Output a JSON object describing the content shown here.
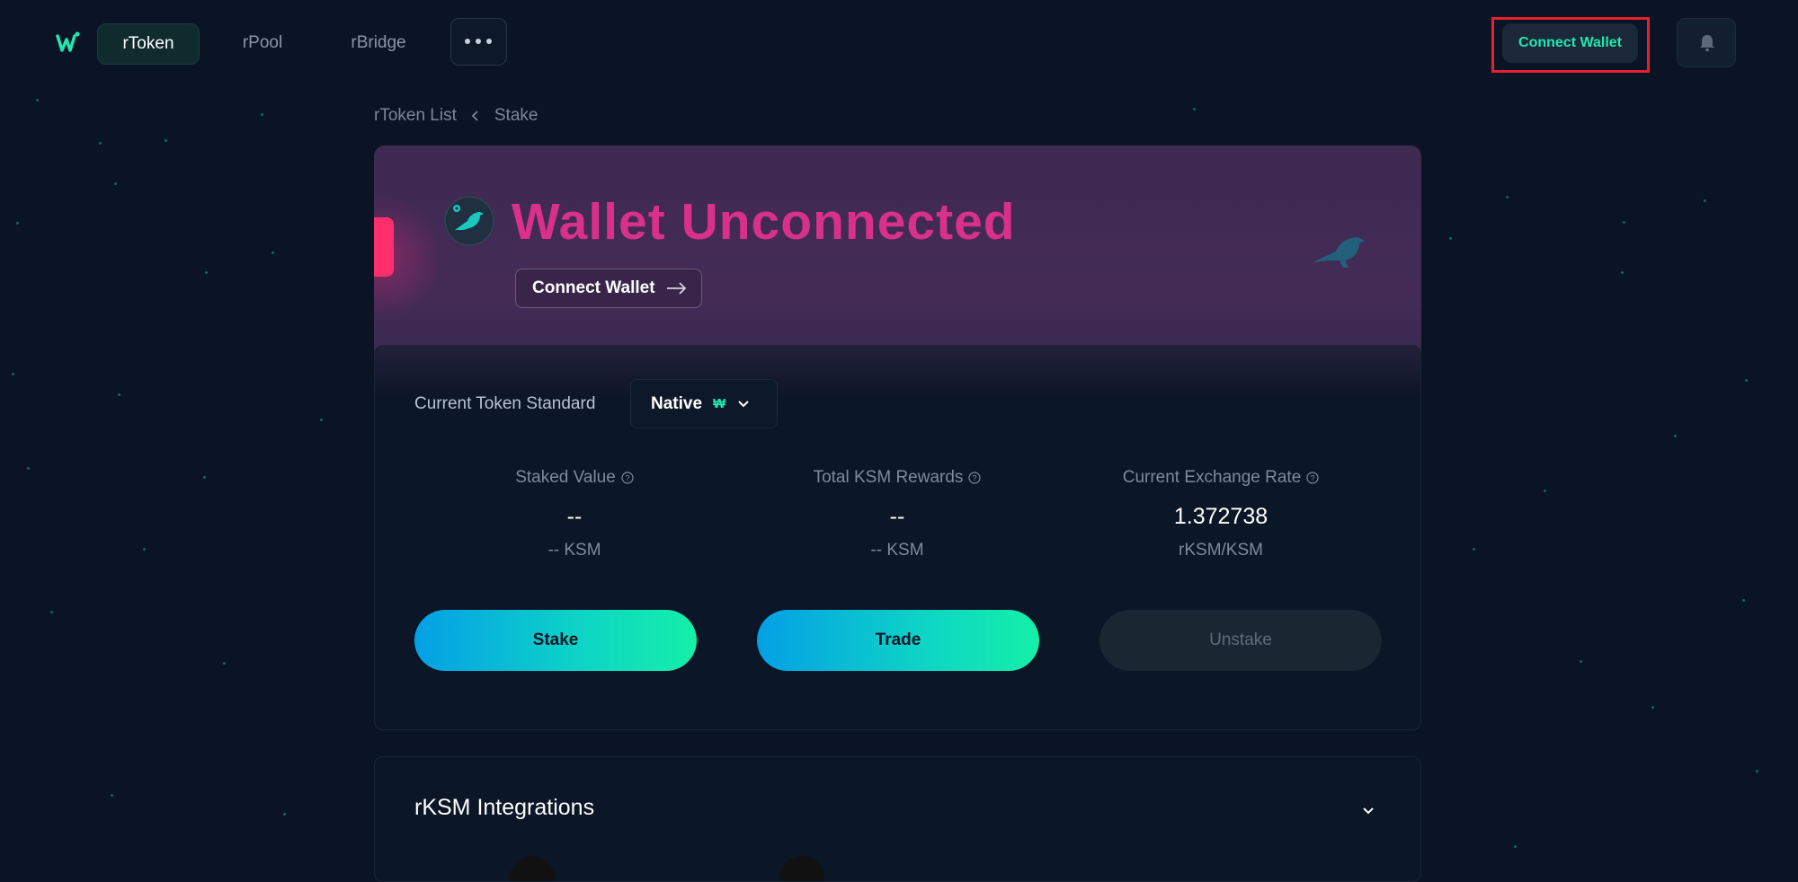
{
  "nav": {
    "items": [
      {
        "label": "rToken",
        "active": true
      },
      {
        "label": "rPool",
        "active": false
      },
      {
        "label": "rBridge",
        "active": false
      }
    ],
    "connect_wallet": "Connect Wallet"
  },
  "breadcrumb": {
    "items": [
      "rToken List",
      "Stake"
    ]
  },
  "hero": {
    "title": "Wallet Unconnected",
    "connect_label": "Connect Wallet"
  },
  "stake_card": {
    "token_standard_label": "Current Token Standard",
    "token_standard_value": "Native",
    "token_symbol": "₩",
    "stats": [
      {
        "label": "Staked Value",
        "value": "--",
        "sub": "-- KSM"
      },
      {
        "label": "Total KSM Rewards",
        "value": "--",
        "sub": "-- KSM"
      },
      {
        "label": "Current Exchange Rate",
        "value": "1.372738",
        "sub": "rKSM/KSM"
      }
    ],
    "actions": {
      "stake": "Stake",
      "trade": "Trade",
      "unstake": "Unstake"
    }
  },
  "integrations": {
    "title": "rKSM Integrations"
  },
  "colors": {
    "background": "#0a1424",
    "accent_green": "#1de9b0",
    "hero_title": "#d9308a",
    "gradient_start": "#049fe6",
    "gradient_end": "#14f0a8"
  },
  "icons": [
    "stafi-logo-icon",
    "more-dots-icon",
    "bell-icon",
    "chevron-left-icon",
    "kusama-bird-icon",
    "arrow-right-icon",
    "chevron-down-icon",
    "help-circle-icon"
  ]
}
